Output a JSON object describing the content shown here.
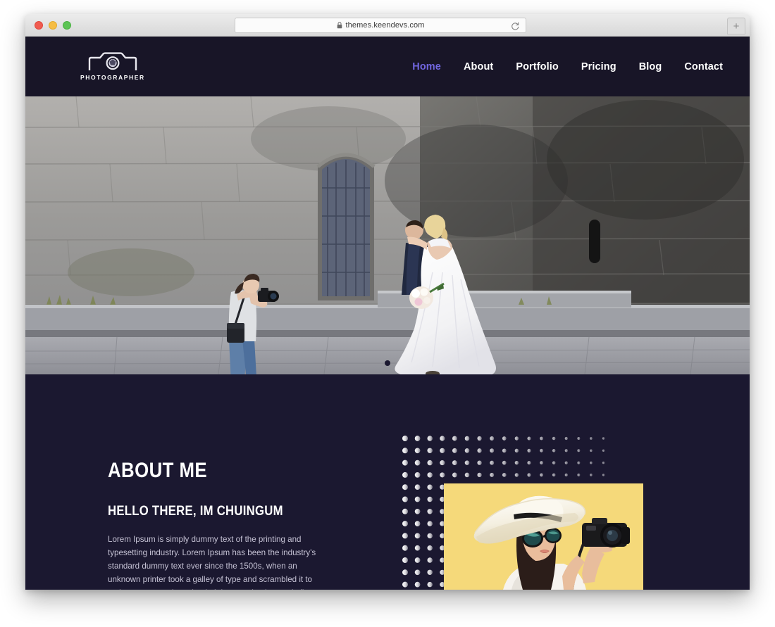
{
  "browser": {
    "url": "themes.keendevs.com",
    "lock_icon": "lock-icon",
    "reload_icon": "reload-icon",
    "newtab_label": "+",
    "traffic_lights": [
      "close-red",
      "minimize-yellow",
      "zoom-green"
    ]
  },
  "site": {
    "logo": {
      "icon": "camera-icon",
      "text": "PHOTOGRAPHER"
    },
    "nav": [
      {
        "label": "Home",
        "active": true
      },
      {
        "label": "About",
        "active": false
      },
      {
        "label": "Portfolio",
        "active": false
      },
      {
        "label": "Pricing",
        "active": false
      },
      {
        "label": "Blog",
        "active": false
      },
      {
        "label": "Contact",
        "active": false
      }
    ],
    "hero": {
      "alt": "Photographer shooting a bride and groom in front of an old stone wall",
      "carousel_dots": 1,
      "active_dot": 0
    },
    "about": {
      "title": "ABOUT ME",
      "subtitle": "HELLO THERE, IM CHUINGUM",
      "body": "Lorem Ipsum is simply dummy text of the printing and typesetting industry. Lorem Ipsum has been the industry's standard dummy text ever since the 1500s, when an unknown printer took a galley of type and scrambled it to make a type specimen book. It has survived not only five centuries, but also",
      "photo_alt": "Woman in a wide-brim white hat and sunglasses holding a camera on a yellow background"
    }
  },
  "colors": {
    "page_bg": "#1b1830",
    "header_bg": "#181527",
    "accent": "#7166e0",
    "text_primary": "#ffffff",
    "text_muted": "#c5c2d4",
    "photo_yellow": "#f5d97a"
  }
}
